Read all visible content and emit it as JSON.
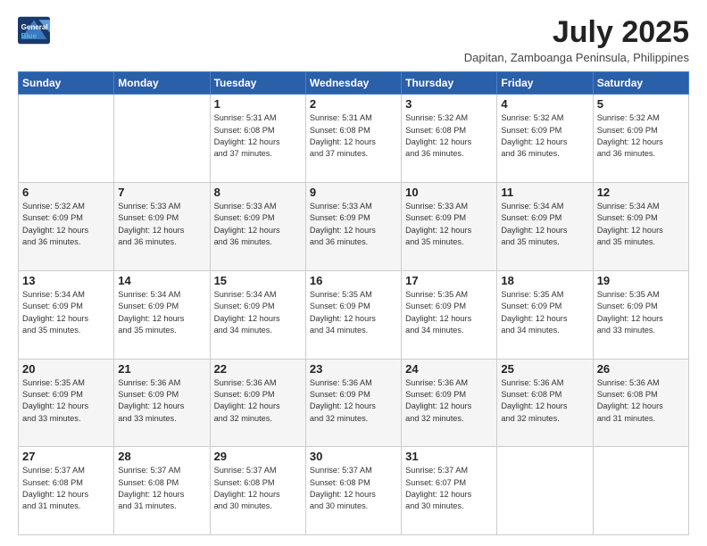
{
  "header": {
    "logo_line1": "General",
    "logo_line2": "Blue",
    "month_year": "July 2025",
    "location": "Dapitan, Zamboanga Peninsula, Philippines"
  },
  "weekdays": [
    "Sunday",
    "Monday",
    "Tuesday",
    "Wednesday",
    "Thursday",
    "Friday",
    "Saturday"
  ],
  "weeks": [
    [
      {
        "day": "",
        "info": ""
      },
      {
        "day": "",
        "info": ""
      },
      {
        "day": "1",
        "info": "Sunrise: 5:31 AM\nSunset: 6:08 PM\nDaylight: 12 hours\nand 37 minutes."
      },
      {
        "day": "2",
        "info": "Sunrise: 5:31 AM\nSunset: 6:08 PM\nDaylight: 12 hours\nand 37 minutes."
      },
      {
        "day": "3",
        "info": "Sunrise: 5:32 AM\nSunset: 6:08 PM\nDaylight: 12 hours\nand 36 minutes."
      },
      {
        "day": "4",
        "info": "Sunrise: 5:32 AM\nSunset: 6:09 PM\nDaylight: 12 hours\nand 36 minutes."
      },
      {
        "day": "5",
        "info": "Sunrise: 5:32 AM\nSunset: 6:09 PM\nDaylight: 12 hours\nand 36 minutes."
      }
    ],
    [
      {
        "day": "6",
        "info": "Sunrise: 5:32 AM\nSunset: 6:09 PM\nDaylight: 12 hours\nand 36 minutes."
      },
      {
        "day": "7",
        "info": "Sunrise: 5:33 AM\nSunset: 6:09 PM\nDaylight: 12 hours\nand 36 minutes."
      },
      {
        "day": "8",
        "info": "Sunrise: 5:33 AM\nSunset: 6:09 PM\nDaylight: 12 hours\nand 36 minutes."
      },
      {
        "day": "9",
        "info": "Sunrise: 5:33 AM\nSunset: 6:09 PM\nDaylight: 12 hours\nand 36 minutes."
      },
      {
        "day": "10",
        "info": "Sunrise: 5:33 AM\nSunset: 6:09 PM\nDaylight: 12 hours\nand 35 minutes."
      },
      {
        "day": "11",
        "info": "Sunrise: 5:34 AM\nSunset: 6:09 PM\nDaylight: 12 hours\nand 35 minutes."
      },
      {
        "day": "12",
        "info": "Sunrise: 5:34 AM\nSunset: 6:09 PM\nDaylight: 12 hours\nand 35 minutes."
      }
    ],
    [
      {
        "day": "13",
        "info": "Sunrise: 5:34 AM\nSunset: 6:09 PM\nDaylight: 12 hours\nand 35 minutes."
      },
      {
        "day": "14",
        "info": "Sunrise: 5:34 AM\nSunset: 6:09 PM\nDaylight: 12 hours\nand 35 minutes."
      },
      {
        "day": "15",
        "info": "Sunrise: 5:34 AM\nSunset: 6:09 PM\nDaylight: 12 hours\nand 34 minutes."
      },
      {
        "day": "16",
        "info": "Sunrise: 5:35 AM\nSunset: 6:09 PM\nDaylight: 12 hours\nand 34 minutes."
      },
      {
        "day": "17",
        "info": "Sunrise: 5:35 AM\nSunset: 6:09 PM\nDaylight: 12 hours\nand 34 minutes."
      },
      {
        "day": "18",
        "info": "Sunrise: 5:35 AM\nSunset: 6:09 PM\nDaylight: 12 hours\nand 34 minutes."
      },
      {
        "day": "19",
        "info": "Sunrise: 5:35 AM\nSunset: 6:09 PM\nDaylight: 12 hours\nand 33 minutes."
      }
    ],
    [
      {
        "day": "20",
        "info": "Sunrise: 5:35 AM\nSunset: 6:09 PM\nDaylight: 12 hours\nand 33 minutes."
      },
      {
        "day": "21",
        "info": "Sunrise: 5:36 AM\nSunset: 6:09 PM\nDaylight: 12 hours\nand 33 minutes."
      },
      {
        "day": "22",
        "info": "Sunrise: 5:36 AM\nSunset: 6:09 PM\nDaylight: 12 hours\nand 32 minutes."
      },
      {
        "day": "23",
        "info": "Sunrise: 5:36 AM\nSunset: 6:09 PM\nDaylight: 12 hours\nand 32 minutes."
      },
      {
        "day": "24",
        "info": "Sunrise: 5:36 AM\nSunset: 6:09 PM\nDaylight: 12 hours\nand 32 minutes."
      },
      {
        "day": "25",
        "info": "Sunrise: 5:36 AM\nSunset: 6:08 PM\nDaylight: 12 hours\nand 32 minutes."
      },
      {
        "day": "26",
        "info": "Sunrise: 5:36 AM\nSunset: 6:08 PM\nDaylight: 12 hours\nand 31 minutes."
      }
    ],
    [
      {
        "day": "27",
        "info": "Sunrise: 5:37 AM\nSunset: 6:08 PM\nDaylight: 12 hours\nand 31 minutes."
      },
      {
        "day": "28",
        "info": "Sunrise: 5:37 AM\nSunset: 6:08 PM\nDaylight: 12 hours\nand 31 minutes."
      },
      {
        "day": "29",
        "info": "Sunrise: 5:37 AM\nSunset: 6:08 PM\nDaylight: 12 hours\nand 30 minutes."
      },
      {
        "day": "30",
        "info": "Sunrise: 5:37 AM\nSunset: 6:08 PM\nDaylight: 12 hours\nand 30 minutes."
      },
      {
        "day": "31",
        "info": "Sunrise: 5:37 AM\nSunset: 6:07 PM\nDaylight: 12 hours\nand 30 minutes."
      },
      {
        "day": "",
        "info": ""
      },
      {
        "day": "",
        "info": ""
      }
    ]
  ]
}
